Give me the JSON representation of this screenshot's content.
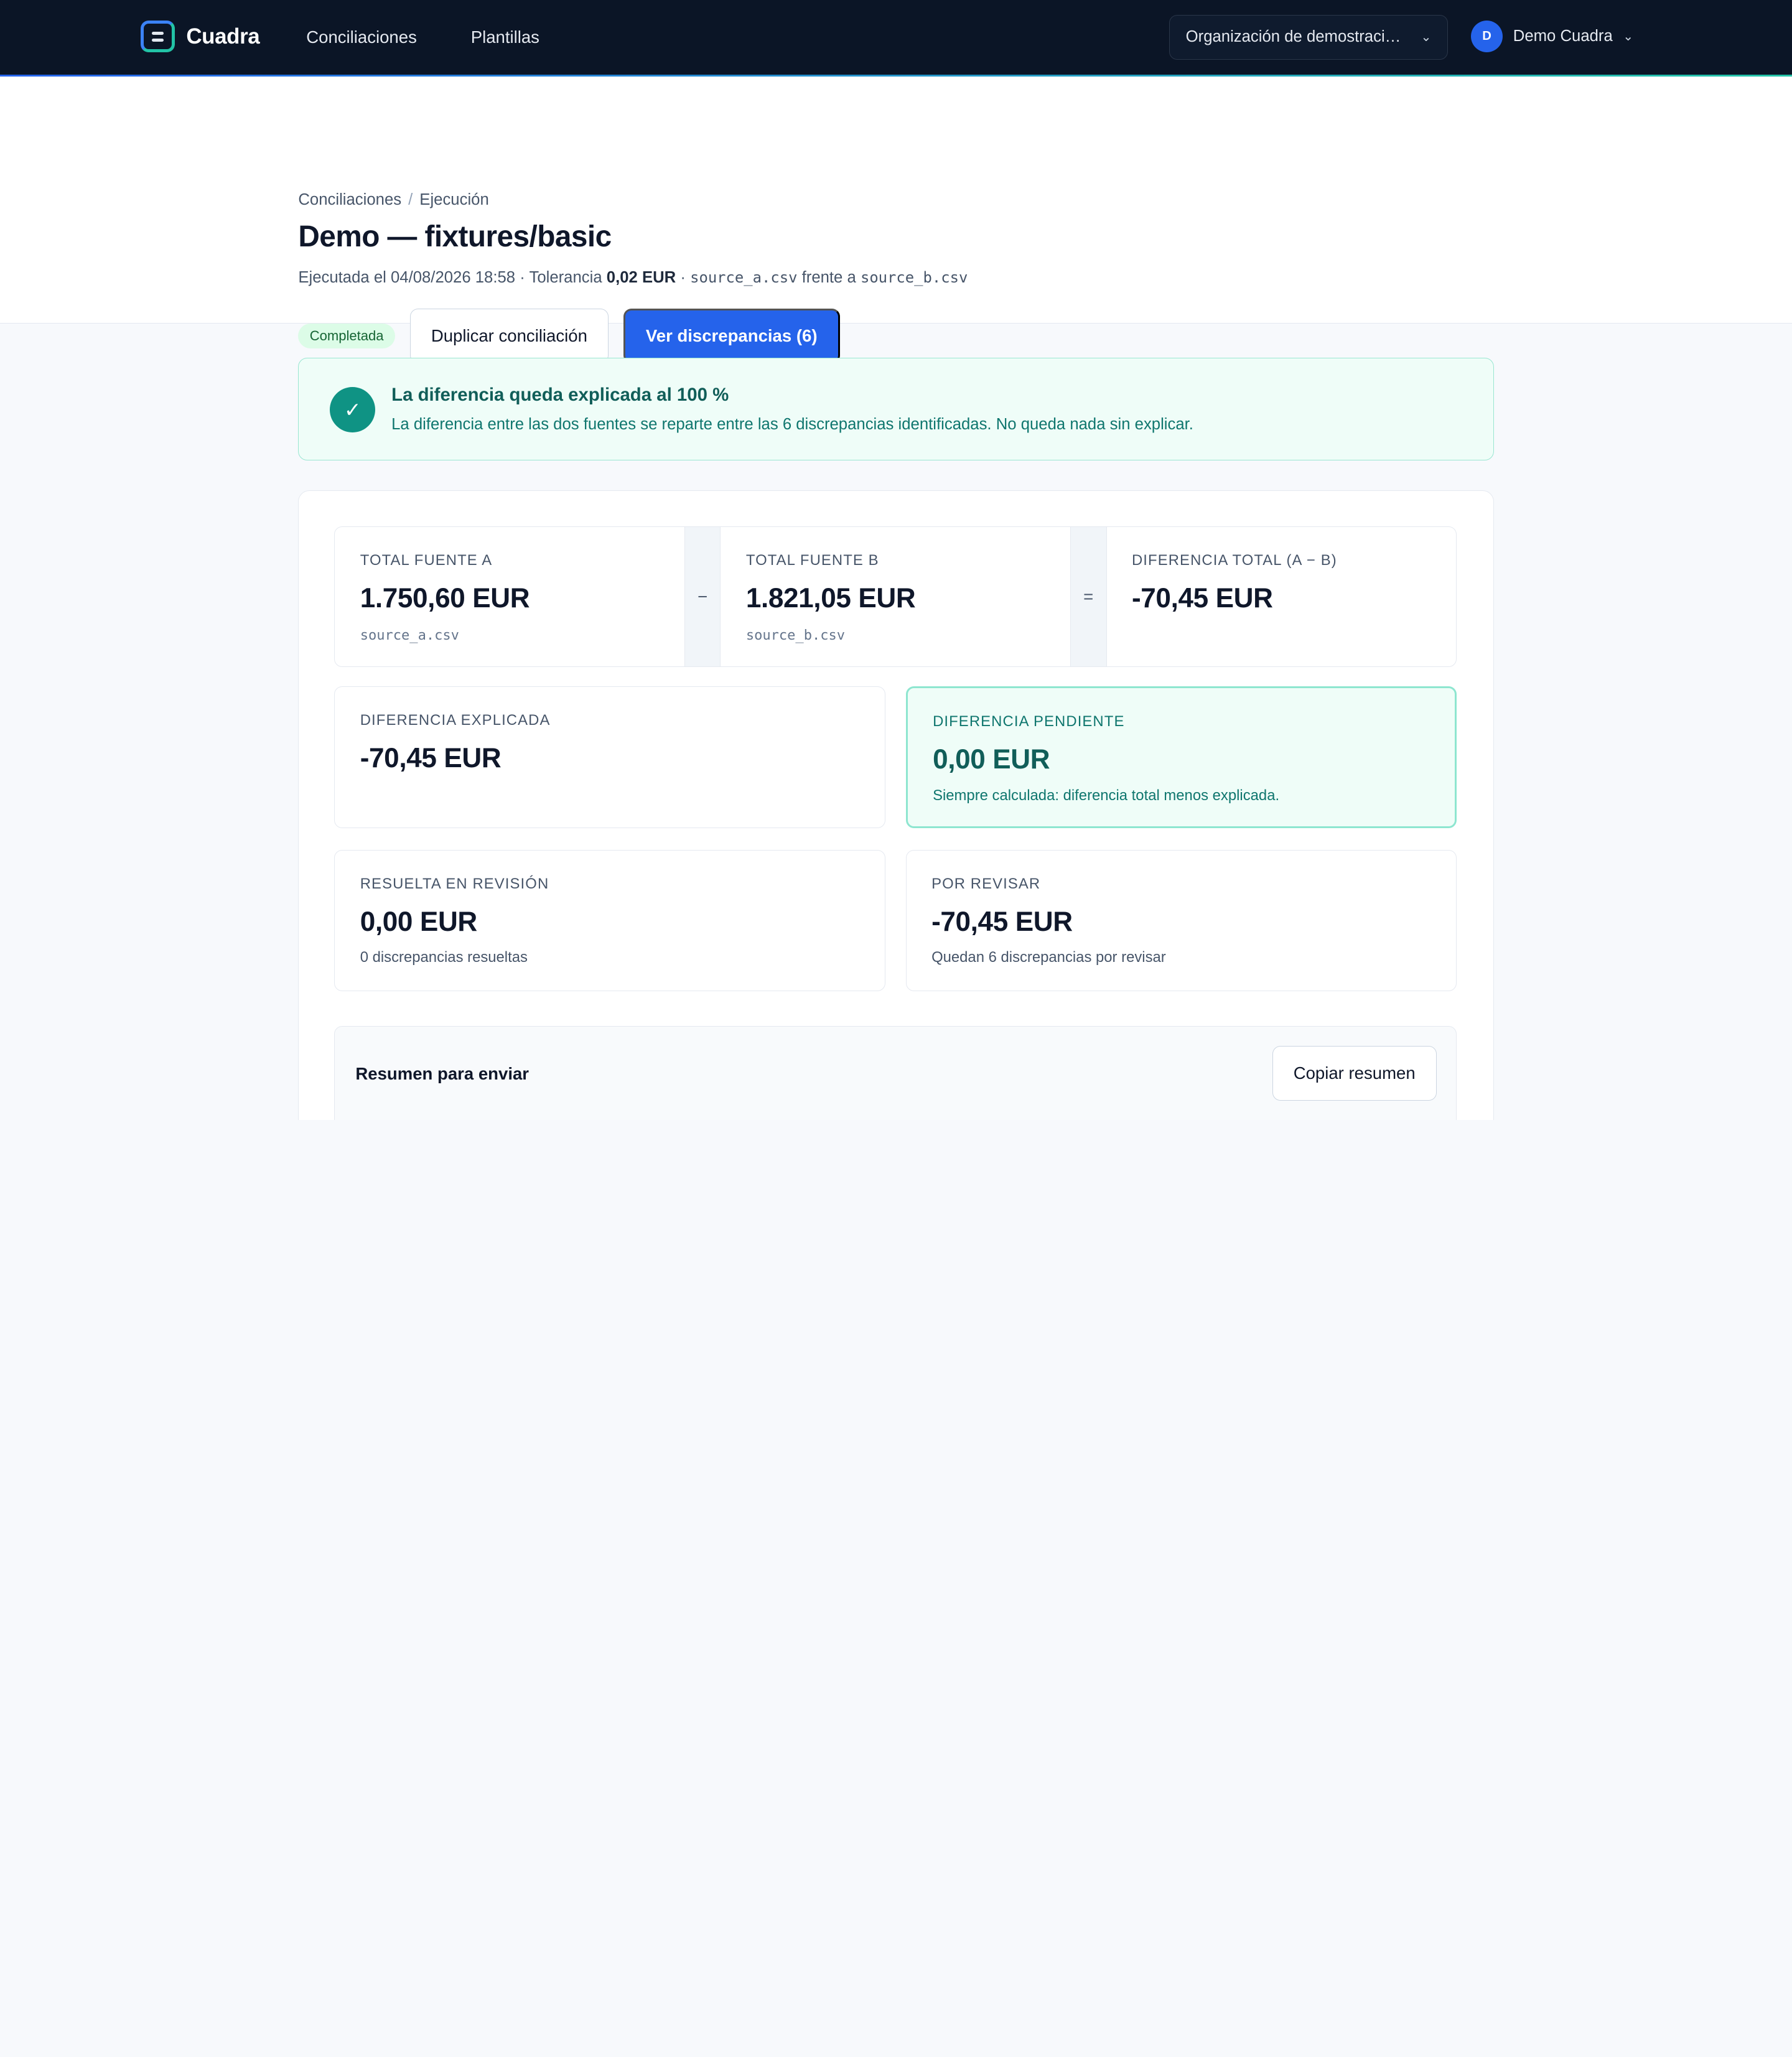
{
  "nav": {
    "brand": "Cuadra",
    "links": [
      "Conciliaciones",
      "Plantillas"
    ],
    "org_select": "Organización de demostraci…",
    "user_initial": "D",
    "user_name": "Demo Cuadra"
  },
  "header": {
    "breadcrumb": [
      "Conciliaciones",
      "Ejecución"
    ],
    "title": "Demo — fixtures/basic",
    "meta_prefix": "Ejecutada el 04/08/2026 18:58 · Tolerancia",
    "tolerance": "0,02 EUR",
    "meta_sep": "·",
    "source_a": "source_a.csv",
    "versus": "frente a",
    "source_b": "source_b.csv",
    "status_badge": "Completada",
    "duplicate_button": "Duplicar conciliación",
    "discrepancies_button": "Ver discrepancias (6)"
  },
  "banner": {
    "title": "La diferencia queda explicada al 100 %",
    "text": "La diferencia entre las dos fuentes se reparte entre las 6 discrepancias identificadas. No queda nada sin explicar."
  },
  "totals": {
    "a": {
      "label": "Total fuente A",
      "amount": "1.750,60 EUR",
      "file": "source_a.csv"
    },
    "minus": "−",
    "b": {
      "label": "Total fuente B",
      "amount": "1.821,05 EUR",
      "file": "source_b.csv"
    },
    "equals": "=",
    "diff": {
      "label": "Diferencia total (A − B)",
      "amount": "-70,45 EUR"
    }
  },
  "boxes": {
    "explained": {
      "label": "Diferencia explicada",
      "amount": "-70,45 EUR"
    },
    "pending": {
      "label": "Diferencia pendiente",
      "amount": "0,00 EUR",
      "note": "Siempre calculada: diferencia total menos explicada."
    },
    "resolved": {
      "label": "Resuelta en revisión",
      "amount": "0,00 EUR",
      "note": "0 discrepancias resueltas"
    },
    "to_review": {
      "label": "Por revisar",
      "amount": "-70,45 EUR",
      "note": "Quedan 6 discrepancias por revisar"
    }
  },
  "summary": {
    "title": "Resumen para enviar",
    "copy_button": "Copiar resumen"
  }
}
